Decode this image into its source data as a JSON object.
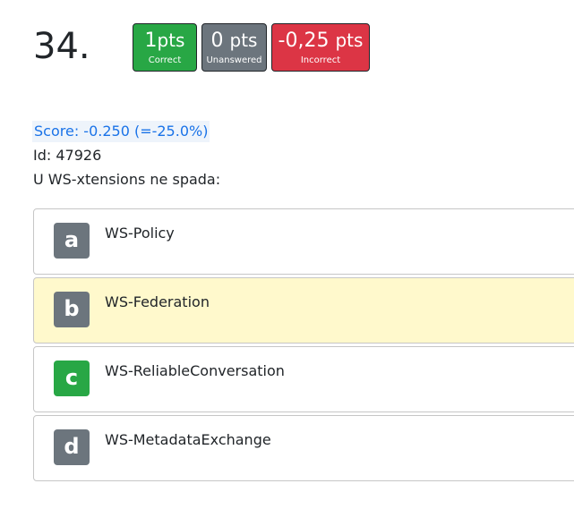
{
  "question": {
    "number": "34.",
    "score": "Score: -0.250 (=-25.0%)",
    "id": "Id: 47926",
    "text": "U WS-xtensions ne spada:"
  },
  "badges": {
    "correct": {
      "value": "1",
      "unit": "pts",
      "label": "Correct",
      "color": "#28a745"
    },
    "unanswered": {
      "value": "0",
      "unit": "pts",
      "label": "Unanswered",
      "color": "#6c757d"
    },
    "incorrect": {
      "value": "-0,25",
      "unit": "pts",
      "label": "Incorrect",
      "color": "#dc3545"
    }
  },
  "answers": [
    {
      "letter": "a",
      "text": "WS-Policy",
      "selected": false,
      "correct": false
    },
    {
      "letter": "b",
      "text": "WS-Federation",
      "selected": true,
      "correct": false
    },
    {
      "letter": "c",
      "text": "WS-ReliableConversation",
      "selected": false,
      "correct": true
    },
    {
      "letter": "d",
      "text": "WS-MetadataExchange",
      "selected": false,
      "correct": false
    }
  ],
  "colors": {
    "selected_bg": "#fff9cc",
    "score_text": "#1a73e8"
  }
}
